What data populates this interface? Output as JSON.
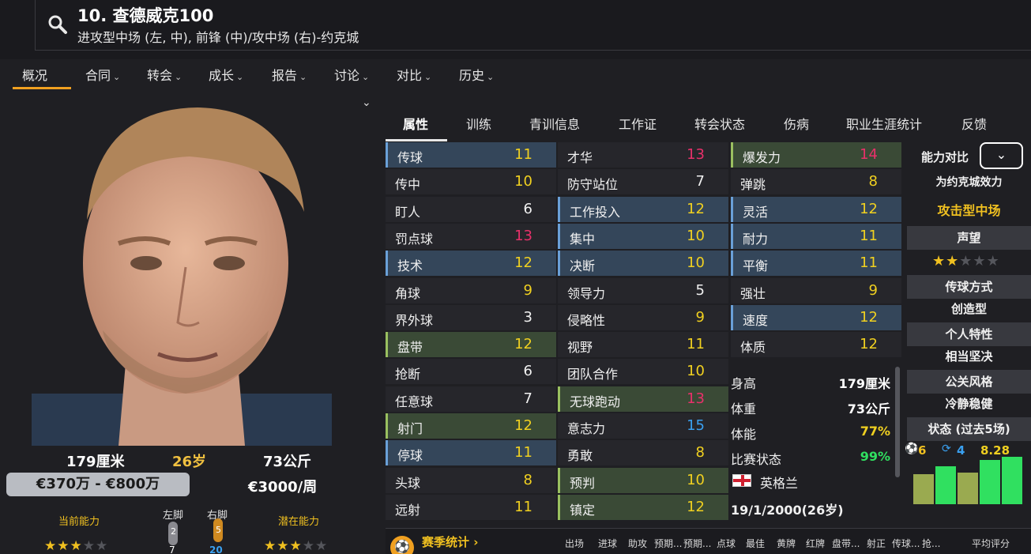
{
  "header": {
    "player_name": "10. 查德威克100",
    "position_line": "进攻型中场 (左, 中), 前锋 (中)/攻中场 (右)-约克城"
  },
  "nav": {
    "items": [
      "概况",
      "合同",
      "转会",
      "成长",
      "报告",
      "讨论",
      "对比",
      "历史"
    ]
  },
  "profile": {
    "height": "179厘米",
    "age": "26岁",
    "weight": "73公斤",
    "value_range": "€370万 - €800万",
    "wage": "€3000/周",
    "current_ability_label": "当前能力",
    "potential_ability_label": "潜在能力",
    "left_foot_label": "左脚",
    "right_foot_label": "右脚",
    "left_foot_value": "2",
    "right_foot_value": "5",
    "left_foot_sub": "7",
    "right_foot_sub": "20",
    "current_ability_stars": 3,
    "potential_ability_stars": 3
  },
  "attr_tabs": [
    "属性",
    "训练",
    "青训信息",
    "工作证",
    "转会状态",
    "伤病",
    "职业生涯统计",
    "反馈"
  ],
  "attributes": {
    "technical": [
      {
        "label": "传球",
        "value": "11",
        "hl": "blue",
        "color": "#f0d020"
      },
      {
        "label": "传中",
        "value": "10",
        "hl": "plain",
        "color": "#f0d020"
      },
      {
        "label": "盯人",
        "value": "6",
        "hl": "plain",
        "color": "#f0f0f0"
      },
      {
        "label": "罚点球",
        "value": "13",
        "hl": "plain",
        "color": "#e8306a"
      },
      {
        "label": "技术",
        "value": "12",
        "hl": "blue",
        "color": "#f0d020"
      },
      {
        "label": "角球",
        "value": "9",
        "hl": "plain",
        "color": "#f0d020"
      },
      {
        "label": "界外球",
        "value": "3",
        "hl": "plain",
        "color": "#f0f0f0"
      },
      {
        "label": "盘带",
        "value": "12",
        "hl": "green",
        "color": "#f0d020"
      },
      {
        "label": "抢断",
        "value": "6",
        "hl": "plain",
        "color": "#f0f0f0"
      },
      {
        "label": "任意球",
        "value": "7",
        "hl": "plain",
        "color": "#f0f0f0"
      },
      {
        "label": "射门",
        "value": "12",
        "hl": "green",
        "color": "#f0d020"
      },
      {
        "label": "停球",
        "value": "11",
        "hl": "blue",
        "color": "#f0d020"
      },
      {
        "label": "头球",
        "value": "8",
        "hl": "plain",
        "color": "#f0d020"
      },
      {
        "label": "远射",
        "value": "11",
        "hl": "plain",
        "color": "#f0d020"
      }
    ],
    "mental": [
      {
        "label": "才华",
        "value": "13",
        "hl": "plain",
        "color": "#e8306a"
      },
      {
        "label": "防守站位",
        "value": "7",
        "hl": "plain",
        "color": "#f0f0f0"
      },
      {
        "label": "工作投入",
        "value": "12",
        "hl": "blue",
        "color": "#f0d020"
      },
      {
        "label": "集中",
        "value": "10",
        "hl": "blue",
        "color": "#f0d020"
      },
      {
        "label": "决断",
        "value": "10",
        "hl": "blue",
        "color": "#f0d020"
      },
      {
        "label": "领导力",
        "value": "5",
        "hl": "plain",
        "color": "#f0f0f0"
      },
      {
        "label": "侵略性",
        "value": "9",
        "hl": "plain",
        "color": "#f0d020"
      },
      {
        "label": "视野",
        "value": "11",
        "hl": "plain",
        "color": "#f0d020"
      },
      {
        "label": "团队合作",
        "value": "10",
        "hl": "plain",
        "color": "#f0d020"
      },
      {
        "label": "无球跑动",
        "value": "13",
        "hl": "green",
        "color": "#e8306a"
      },
      {
        "label": "意志力",
        "value": "15",
        "hl": "plain",
        "color": "#3aa0f0"
      },
      {
        "label": "勇敢",
        "value": "8",
        "hl": "plain",
        "color": "#f0d020"
      },
      {
        "label": "预判",
        "value": "10",
        "hl": "green",
        "color": "#f0d020"
      },
      {
        "label": "镇定",
        "value": "12",
        "hl": "green",
        "color": "#f0d020"
      }
    ],
    "physical": [
      {
        "label": "爆发力",
        "value": "14",
        "hl": "green",
        "color": "#e8306a"
      },
      {
        "label": "弹跳",
        "value": "8",
        "hl": "plain",
        "color": "#f0d020"
      },
      {
        "label": "灵活",
        "value": "12",
        "hl": "blue",
        "color": "#f0d020"
      },
      {
        "label": "耐力",
        "value": "11",
        "hl": "blue",
        "color": "#f0d020"
      },
      {
        "label": "平衡",
        "value": "11",
        "hl": "blue",
        "color": "#f0d020"
      },
      {
        "label": "强壮",
        "value": "9",
        "hl": "plain",
        "color": "#f0d020"
      },
      {
        "label": "速度",
        "value": "12",
        "hl": "blue",
        "color": "#f0d020"
      },
      {
        "label": "体质",
        "value": "12",
        "hl": "plain",
        "color": "#f0d020"
      }
    ]
  },
  "info": [
    {
      "label": "身高",
      "value": "179厘米",
      "color": "#ffffff"
    },
    {
      "label": "体重",
      "value": "73公斤",
      "color": "#ffffff"
    },
    {
      "label": "体能",
      "value": "77%",
      "color": "#f0d020"
    },
    {
      "label": "比赛状态",
      "value": "99%",
      "color": "#30e060"
    }
  ],
  "nationality": "英格兰",
  "birth": "19/1/2000(26岁)",
  "side_panel": {
    "compare_label": "能力对比",
    "plays_for": "为约克城效力",
    "role": "攻击型中场",
    "reputation_label": "声望",
    "reputation_stars": 2,
    "passing_style_label": "传球方式",
    "passing_style": "创造型",
    "personality_label": "个人特性",
    "personality": "相当坚决",
    "media_label": "公关风格",
    "media": "冷静稳健",
    "form_label": "状态 (过去5场)",
    "goals": "6",
    "assists": "4",
    "rating": "8.28",
    "form_bars": [
      6.9,
      7.4,
      7.0,
      7.8,
      8.0
    ]
  },
  "bottom": {
    "season_stats": "赛季统计",
    "columns": [
      "出场",
      "进球",
      "助攻",
      "预期...",
      "预期...",
      "点球",
      "最佳",
      "黄牌",
      "红牌",
      "盘带...",
      "射正",
      "传球...",
      "抢...",
      "平均评分"
    ]
  },
  "colors": {
    "accent": "#f0a020",
    "yellow_value": "#f0d020",
    "red_value": "#e8306a",
    "blue_value": "#3aa0f0"
  }
}
